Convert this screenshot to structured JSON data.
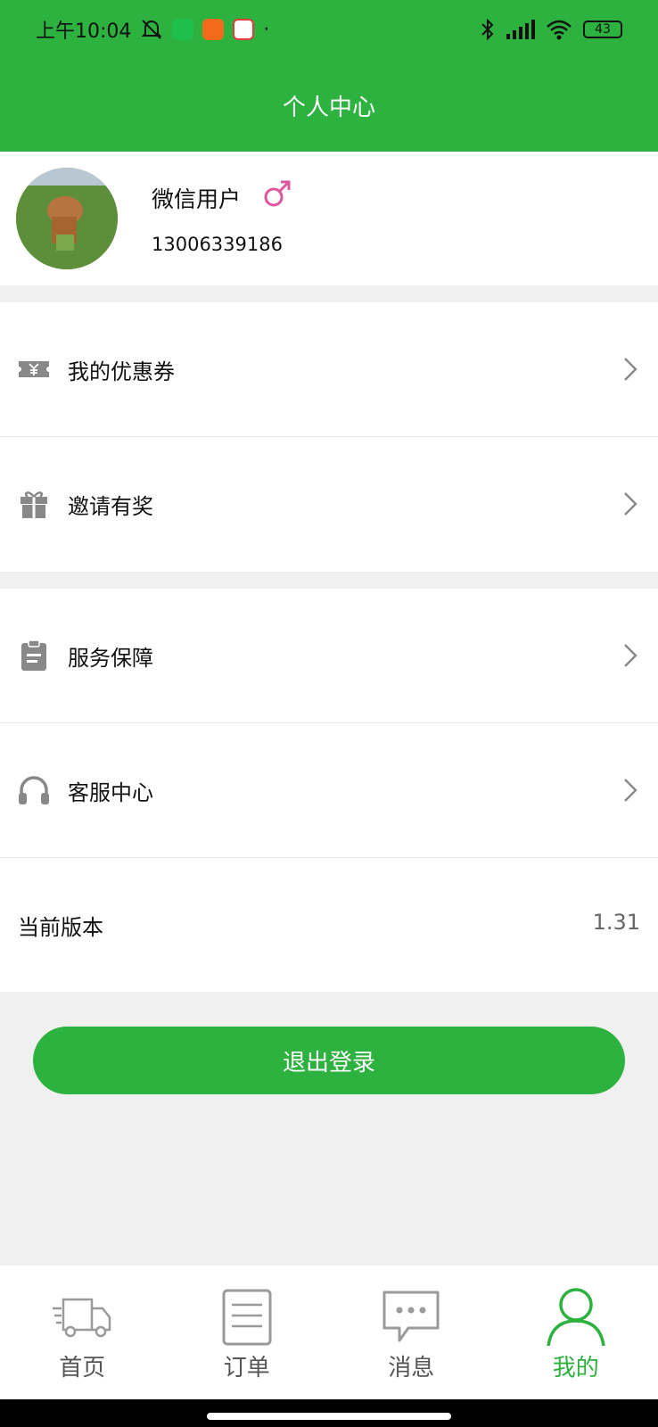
{
  "status_bar": {
    "time": "上午10:04",
    "battery": "43",
    "dot": "·"
  },
  "header": {
    "title": "个人中心"
  },
  "profile": {
    "name": "微信用户",
    "gender_symbol": "♂",
    "phone": "13006339186"
  },
  "menu": {
    "coupons": "我的优惠券",
    "invite": "邀请有奖",
    "service": "服务保障",
    "support": "客服中心"
  },
  "version": {
    "label": "当前版本",
    "value": "1.31"
  },
  "logout_label": "退出登录",
  "tabs": [
    {
      "label": "首页",
      "icon": "truck-icon"
    },
    {
      "label": "订单",
      "icon": "document-icon"
    },
    {
      "label": "消息",
      "icon": "chat-bubble-icon"
    },
    {
      "label": "我的",
      "icon": "person-icon"
    }
  ],
  "colors": {
    "brand_green": "#2db13f",
    "gender_pink": "#e0569e",
    "icon_gray": "#888888"
  }
}
